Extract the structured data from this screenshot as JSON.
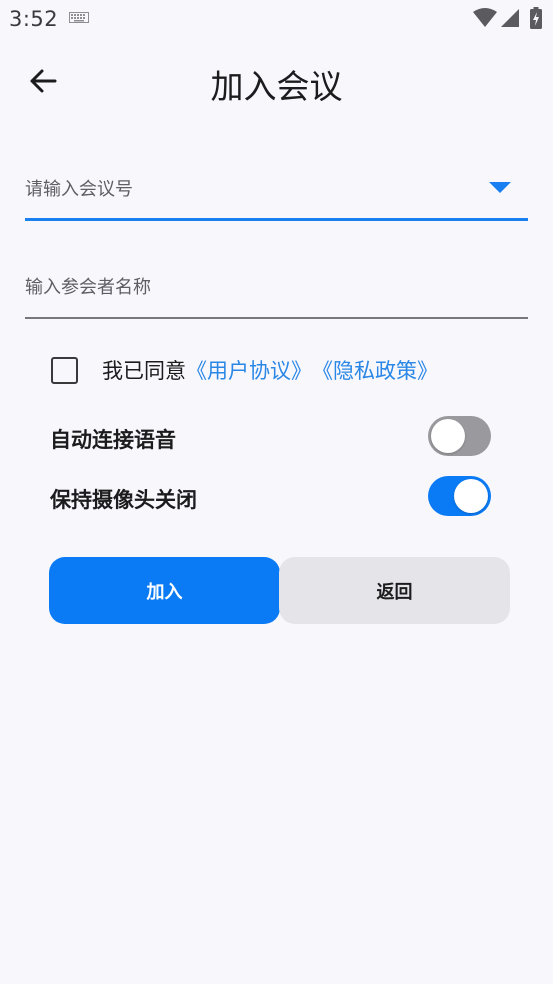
{
  "status_bar": {
    "time": "3:52",
    "icons": [
      "keyboard-icon",
      "wifi-icon",
      "signal-icon",
      "battery-charging-icon"
    ]
  },
  "header": {
    "title": "加入会议",
    "back_icon": "arrow-left-icon"
  },
  "form": {
    "meeting_number": {
      "placeholder": "请输入会议号",
      "value": ""
    },
    "participant_name": {
      "placeholder": "输入参会者名称",
      "value": ""
    }
  },
  "agreement": {
    "checked": false,
    "prefix": "我已同意",
    "user_agreement": "《用户协议》",
    "privacy_policy": "《隐私政策》"
  },
  "toggles": {
    "auto_connect_audio": {
      "label": "自动连接语音",
      "on": false
    },
    "keep_camera_off": {
      "label": "保持摄像头关闭",
      "on": true
    }
  },
  "buttons": {
    "join": "加入",
    "back": "返回"
  },
  "colors": {
    "accent": "#0a7bf5",
    "link": "#2a87e6",
    "background": "#f7f7fc",
    "secondary_button": "#e4e4e9",
    "toggle_off": "#9a9a9e"
  }
}
